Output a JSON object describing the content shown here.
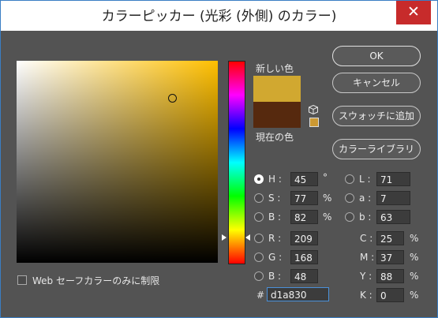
{
  "window": {
    "title": "カラーピッカー (光彩 (外側) のカラー)",
    "close_glyph": "✕"
  },
  "swatches": {
    "new_label": "新しい色",
    "current_label": "現在の色",
    "new_color": "#d1a830",
    "current_color": "#56290e"
  },
  "buttons": {
    "ok": "OK",
    "cancel": "キャンセル",
    "add_swatch": "スウォッチに追加",
    "libraries": "カラーライブラリ"
  },
  "hsb": {
    "h": {
      "label": "H :",
      "value": "45",
      "unit": "°",
      "selected": true
    },
    "s": {
      "label": "S :",
      "value": "77",
      "unit": "%"
    },
    "b": {
      "label": "B :",
      "value": "82",
      "unit": "%"
    }
  },
  "lab": {
    "l": {
      "label": "L :",
      "value": "71"
    },
    "a": {
      "label": "a :",
      "value": "7"
    },
    "b": {
      "label": "b :",
      "value": "63"
    }
  },
  "rgb": {
    "r": {
      "label": "R :",
      "value": "209"
    },
    "g": {
      "label": "G :",
      "value": "168"
    },
    "b": {
      "label": "B :",
      "value": "48"
    }
  },
  "cmyk": {
    "c": {
      "label": "C :",
      "value": "25",
      "unit": "%"
    },
    "m": {
      "label": "M :",
      "value": "37",
      "unit": "%"
    },
    "y": {
      "label": "Y :",
      "value": "88",
      "unit": "%"
    },
    "k": {
      "label": "K :",
      "value": "0",
      "unit": "%"
    }
  },
  "hex": {
    "label": "#",
    "value": "d1a830"
  },
  "websafe": {
    "label": "Web セーフカラーのみに制限",
    "checked": false
  },
  "colors": {
    "accent": "#3a7ec4",
    "close_bg": "#c72b2b",
    "panel_bg": "#535353"
  }
}
